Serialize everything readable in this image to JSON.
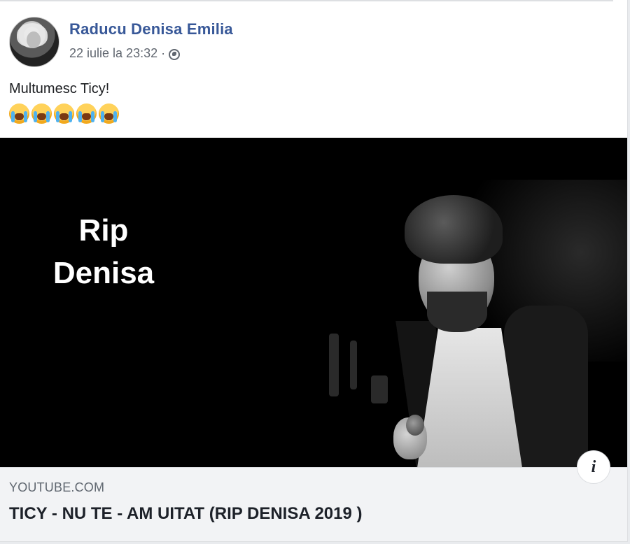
{
  "post": {
    "author": "Raducu Denisa Emilia",
    "timestamp": "22 iulie la 23:32",
    "separator": "·",
    "privacy_icon": "globe-icon",
    "text": "Multumesc Ticy!",
    "emojis": [
      "crying-face",
      "crying-face",
      "crying-face",
      "crying-face",
      "crying-face"
    ]
  },
  "video": {
    "overlay_line1": "Rip",
    "overlay_line2": "Denisa"
  },
  "link_preview": {
    "domain": "YOUTUBE.COM",
    "title": "TICY - NU TE - AM UITAT (RIP DENISA 2019 )",
    "info_label": "i"
  },
  "colors": {
    "author": "#385898",
    "meta": "#616770",
    "link_bg": "#f2f3f5"
  }
}
